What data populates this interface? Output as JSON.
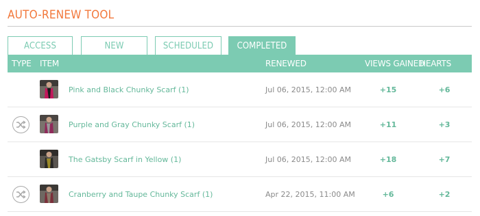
{
  "page": {
    "title": "AUTO-RENEW TOOL"
  },
  "tabs": [
    {
      "label": "ACCESS",
      "active": false
    },
    {
      "label": "NEW",
      "active": false
    },
    {
      "label": "SCHEDULED",
      "active": false
    },
    {
      "label": "COMPLETED",
      "active": true
    }
  ],
  "table": {
    "headers": {
      "type": "TYPE",
      "item": "ITEM",
      "renewed": "RENEWED",
      "views": "VIEWS GAINED",
      "hearts": "HEARTS GAINED"
    },
    "rows": [
      {
        "type_icon": "",
        "thumb_color": "#c2185b",
        "item": "Pink and Black Chunky Scarf (1)",
        "renewed": "Jul 06, 2015, 12:00 AM",
        "views": "+15",
        "hearts": "+6"
      },
      {
        "type_icon": "shuffle-icon",
        "thumb_color": "#8e2a5a",
        "item": "Purple and Gray Chunky Scarf (1)",
        "renewed": "Jul 06, 2015, 12:00 AM",
        "views": "+11",
        "hearts": "+3"
      },
      {
        "type_icon": "",
        "thumb_color": "#9b8a2a",
        "item": "The Gatsby Scarf in Yellow (1)",
        "renewed": "Jul 06, 2015, 12:00 AM",
        "views": "+18",
        "hearts": "+7"
      },
      {
        "type_icon": "shuffle-icon",
        "thumb_color": "#7a2f3a",
        "item": "Cranberry and Taupe Chunky Scarf (1)",
        "renewed": "Apr 22, 2015, 11:00 AM",
        "views": "+6",
        "hearts": "+2"
      }
    ]
  },
  "colors": {
    "accent": "#7ccbb2",
    "title": "#f2773a",
    "link": "#64b89a"
  }
}
